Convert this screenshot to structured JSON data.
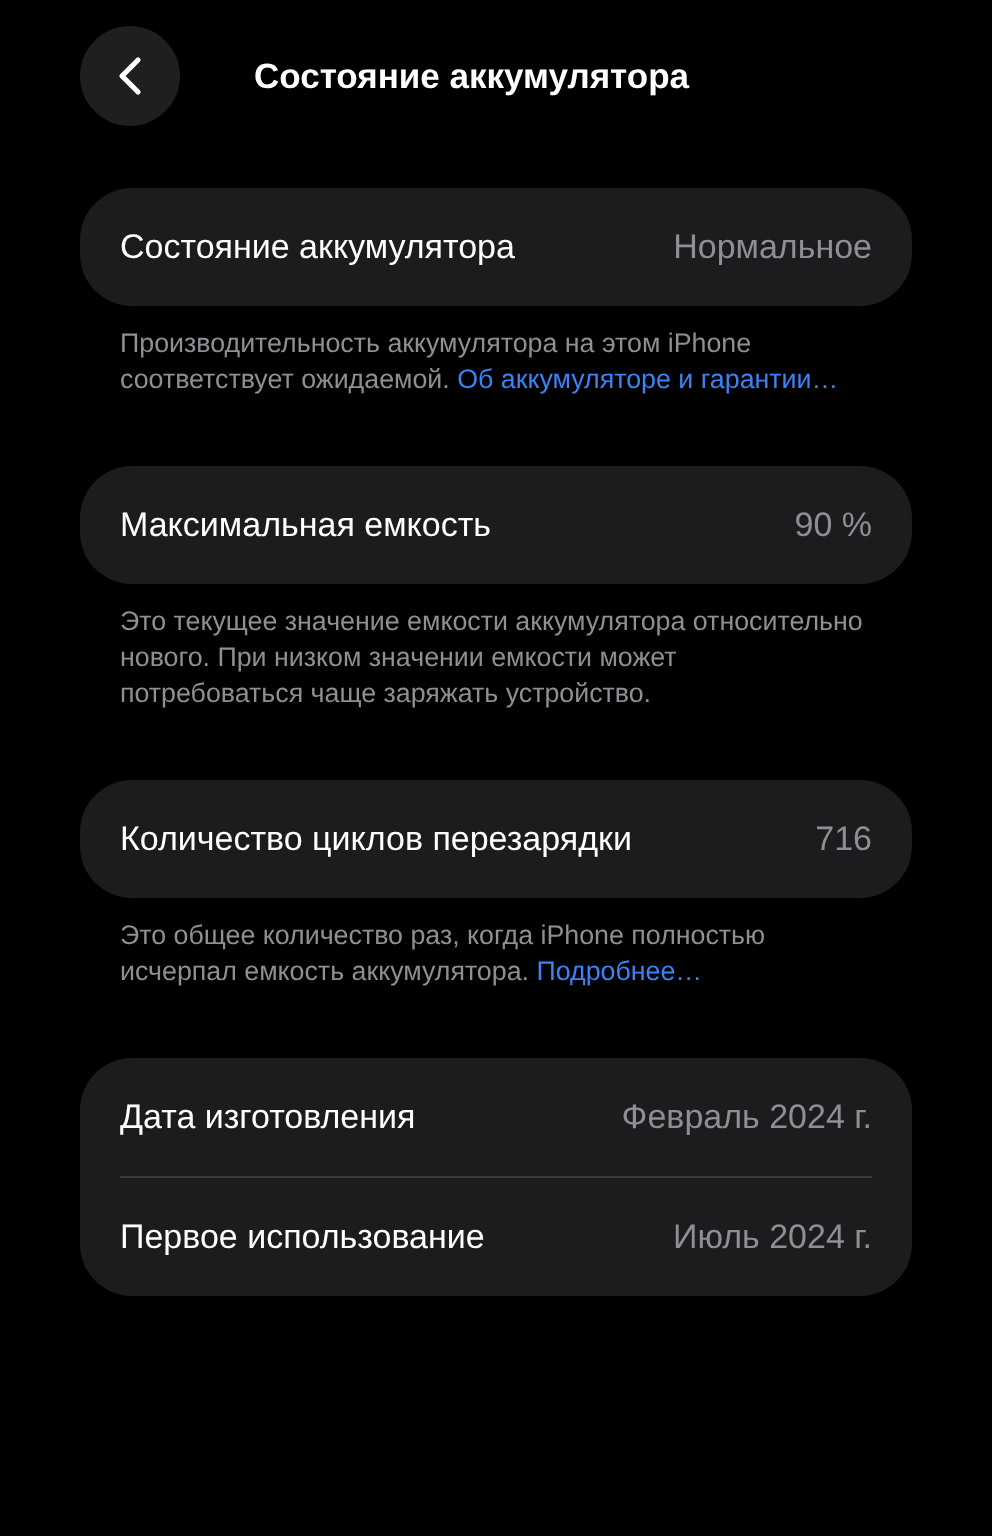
{
  "header": {
    "title": "Состояние аккумулятора"
  },
  "sections": [
    {
      "rows": [
        {
          "label": "Состояние аккумулятора",
          "value": "Нормальное"
        }
      ],
      "note": {
        "text": "Производительность аккумулятора на этом iPhone соответствует ожидаемой.",
        "link": "Об аккумуляторе и гарантии…"
      }
    },
    {
      "rows": [
        {
          "label": "Максимальная емкость",
          "value": "90 %"
        }
      ],
      "note": {
        "text": "Это текущее значение емкости аккумулятора относительно нового. При низком значении емкости может потребоваться чаще заряжать устройство."
      }
    },
    {
      "rows": [
        {
          "label": "Количество циклов перезарядки",
          "value": "716"
        }
      ],
      "note": {
        "text": "Это общее количество раз, когда iPhone полностью исчерпал емкость аккумулятора.",
        "link": "Подробнее…"
      }
    },
    {
      "rows": [
        {
          "label": "Дата изготовления",
          "value": "Февраль 2024 г."
        },
        {
          "label": "Первое использование",
          "value": "Июль 2024 г."
        }
      ]
    }
  ]
}
